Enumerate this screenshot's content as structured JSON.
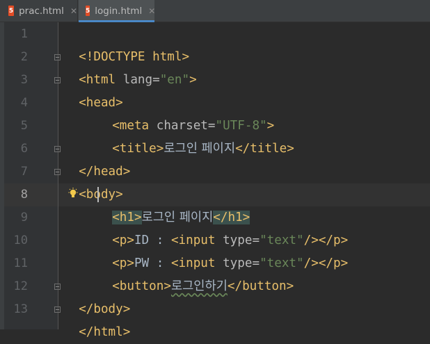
{
  "tabs": [
    {
      "label": "prac.html",
      "icon": "html5-file-icon",
      "active": false
    },
    {
      "label": "login.html",
      "icon": "html5-file-icon",
      "active": true
    }
  ],
  "close_glyph": "✕",
  "html_icon_glyph": "5",
  "current_line": 8,
  "accent_color": "#4a88c7",
  "line_numbers": [
    "1",
    "2",
    "3",
    "4",
    "5",
    "6",
    "7",
    "8",
    "9",
    "10",
    "11",
    "12",
    "13"
  ],
  "code": {
    "l1": {
      "open": "<!DOCTYPE html>"
    },
    "l2": {
      "lt": "<",
      "tag": "html",
      "attr": " lang=",
      "val": "\"en\"",
      "gt": ">"
    },
    "l3": {
      "lt": "<",
      "tag": "head",
      "gt": ">"
    },
    "l4": {
      "lt": "<",
      "tag": "meta",
      "attr": " charset=",
      "val": "\"UTF-8\"",
      "gt": ">"
    },
    "l5": {
      "lt": "<",
      "tag": "title",
      "gt": ">",
      "text": "로그인 페이지",
      "clt": "</",
      "ctag": "title",
      "cgt": ">"
    },
    "l6": {
      "clt": "</",
      "ctag": "head",
      "cgt": ">"
    },
    "l7": {
      "lt": "<",
      "tag": "body",
      "gt": ">"
    },
    "l8": {
      "lt": "<",
      "tag": "h1",
      "gt": ">",
      "text": "로그인 페이지",
      "clt": "</",
      "ctag": "h1",
      "cgt": ">"
    },
    "l9": {
      "lt": "<",
      "tag": "p",
      "gt": ">",
      "text": "ID : ",
      "ilt": "<",
      "itag": "input",
      "iattr": " type=",
      "ival": "\"text\"",
      "islash": "/>",
      "clt": "</",
      "ctag": "p",
      "cgt": ">"
    },
    "l10": {
      "lt": "<",
      "tag": "p",
      "gt": ">",
      "text": "PW : ",
      "ilt": "<",
      "itag": "input",
      "iattr": " type=",
      "ival": "\"text\"",
      "islash": "/>",
      "clt": "</",
      "ctag": "p",
      "cgt": ">"
    },
    "l11": {
      "lt": "<",
      "tag": "button",
      "gt": ">",
      "text": "로그인하기",
      "clt": "</",
      "ctag": "button",
      "cgt": ">"
    },
    "l12": {
      "clt": "</",
      "ctag": "body",
      "cgt": ">"
    },
    "l13": {
      "clt": "</",
      "ctag": "html",
      "cgt": ">"
    }
  }
}
